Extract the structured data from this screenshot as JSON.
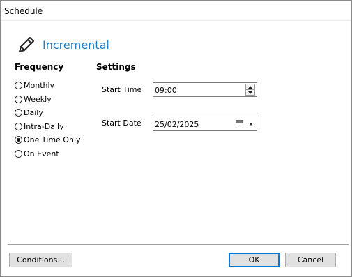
{
  "window": {
    "title": "Schedule"
  },
  "header": {
    "icon": "pencil-icon",
    "title": "Incremental",
    "title_color": "#1f7fc6"
  },
  "frequency": {
    "label": "Frequency",
    "options": [
      {
        "label": "Monthly",
        "checked": false
      },
      {
        "label": "Weekly",
        "checked": false
      },
      {
        "label": "Daily",
        "checked": false
      },
      {
        "label": "Intra-Daily",
        "checked": false
      },
      {
        "label": "One Time Only",
        "checked": true
      },
      {
        "label": "On Event",
        "checked": false
      }
    ]
  },
  "settings": {
    "label": "Settings",
    "start_time": {
      "label": "Start Time",
      "value": "09:00"
    },
    "start_date": {
      "label": "Start Date",
      "value": "25/02/2025"
    }
  },
  "buttons": {
    "conditions": "Conditions...",
    "ok": "OK",
    "cancel": "Cancel"
  },
  "colors": {
    "accent": "#0078d7",
    "heading": "#1f7fc6"
  }
}
